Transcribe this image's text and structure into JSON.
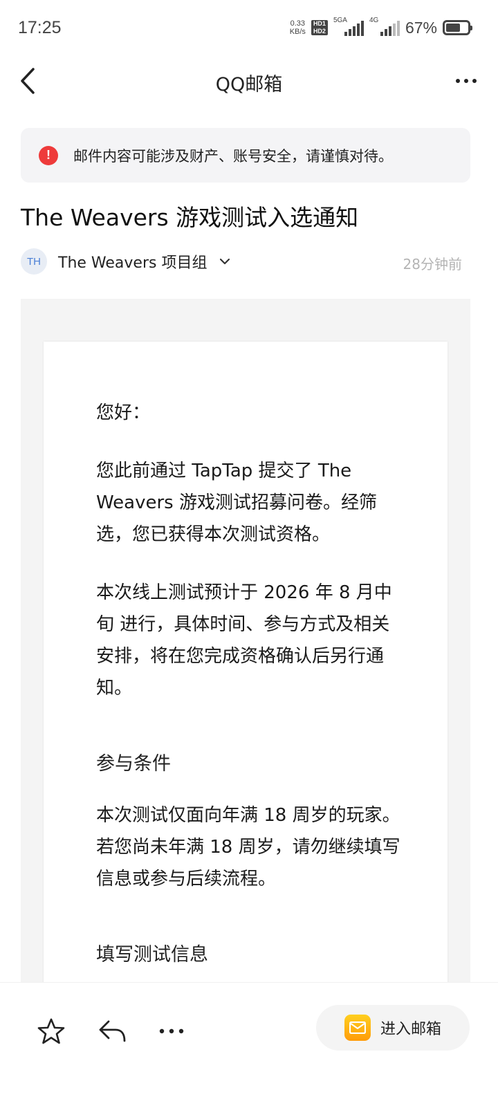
{
  "status_bar": {
    "time": "17:25",
    "net_speed_value": "0.33",
    "net_speed_unit": "KB/s",
    "hd1": "HD1",
    "hd2": "HD2",
    "signal1_label": "5GA",
    "signal2_label": "4G",
    "battery_text": "67%",
    "battery_level": 0.67
  },
  "nav": {
    "title": "QQ邮箱",
    "back_icon": "chevron-left-icon",
    "more_icon": "more-horizontal-icon"
  },
  "warning": {
    "icon": "!",
    "text": "邮件内容可能涉及财产、账号安全，请谨慎对待。",
    "icon_color": "#ee3b3b"
  },
  "mail": {
    "subject": "The Weavers 游戏测试入选通知",
    "sender_initials": "TH",
    "sender_name": "The Weavers 项目组",
    "time": "28分钟前"
  },
  "body": {
    "greeting": "您好：",
    "p1": "您此前通过 TapTap 提交了 The Weavers 游戏测试招募问卷。经筛选，您已获得本次测试资格。",
    "p2": "本次线上测试预计于 2026 年 8 月中旬 进行，具体时间、参与方式及相关安排，将在您完成资格确认后另行通知。",
    "h_conditions": "参与条件",
    "p3": "本次测试仅面向年满 18 周岁的玩家。若您尚未年满 18 周岁，请勿继续填写信息或参与后续流程。",
    "h_fill": "填写测试信息"
  },
  "bottom_bar": {
    "star_icon": "star-icon",
    "reply_icon": "reply-icon",
    "more_icon": "more-horizontal-icon",
    "enter_label": "进入邮箱",
    "enter_icon": "mail-icon"
  },
  "colors": {
    "accent_mail": "#ffb414",
    "warning_bg": "#f4f4f6"
  }
}
